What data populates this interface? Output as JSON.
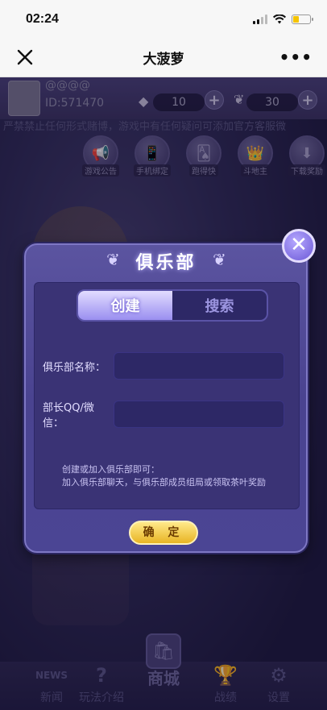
{
  "status_bar": {
    "time": "02:24",
    "battery_level": 0.35
  },
  "nav": {
    "title": "大菠萝",
    "more": "•••"
  },
  "top_bar": {
    "username": "@@@@",
    "user_id": "ID:571470",
    "diamonds": "10",
    "tea_leaves": "30",
    "plus": "+"
  },
  "marquee": "严禁禁止任何形式赌博，游戏中有任何疑问可添加官方客服微",
  "quick_buttons": [
    {
      "label": "游戏公告",
      "icon": "megaphone-icon",
      "glyph": "📢"
    },
    {
      "label": "手机绑定",
      "icon": "phone-icon",
      "glyph": "📱"
    },
    {
      "label": "跑得快",
      "icon": "cards-icon",
      "glyph": "🂡"
    },
    {
      "label": "斗地主",
      "icon": "landlord-icon",
      "glyph": "👑"
    },
    {
      "label": "下载奖励",
      "icon": "download-icon",
      "glyph": "⬇"
    }
  ],
  "dialog": {
    "title": "俱乐部",
    "tabs": {
      "create": "创建",
      "search": "搜索"
    },
    "club_name_label": "俱乐部名称：",
    "club_name_value": "",
    "leader_contact_label": "部长QQ/微信：",
    "leader_contact_value": "",
    "hint_line1": "创建或加入俱乐部即可：",
    "hint_line2": "加入俱乐部聊天，与俱乐部成员组局或领取茶叶奖励",
    "confirm": "确 定"
  },
  "bottom_nav": [
    {
      "label": "新闻",
      "icon": "news-icon",
      "glyph": "NEWS"
    },
    {
      "label": "玩法介绍",
      "icon": "help-icon",
      "glyph": "?"
    },
    {
      "label": "战绩",
      "icon": "trophy-icon",
      "glyph": "🏆"
    },
    {
      "label": "设置",
      "icon": "settings-gear-icon",
      "glyph": "⚙"
    }
  ],
  "shop": {
    "label": "商城",
    "glyph": "🛍"
  }
}
